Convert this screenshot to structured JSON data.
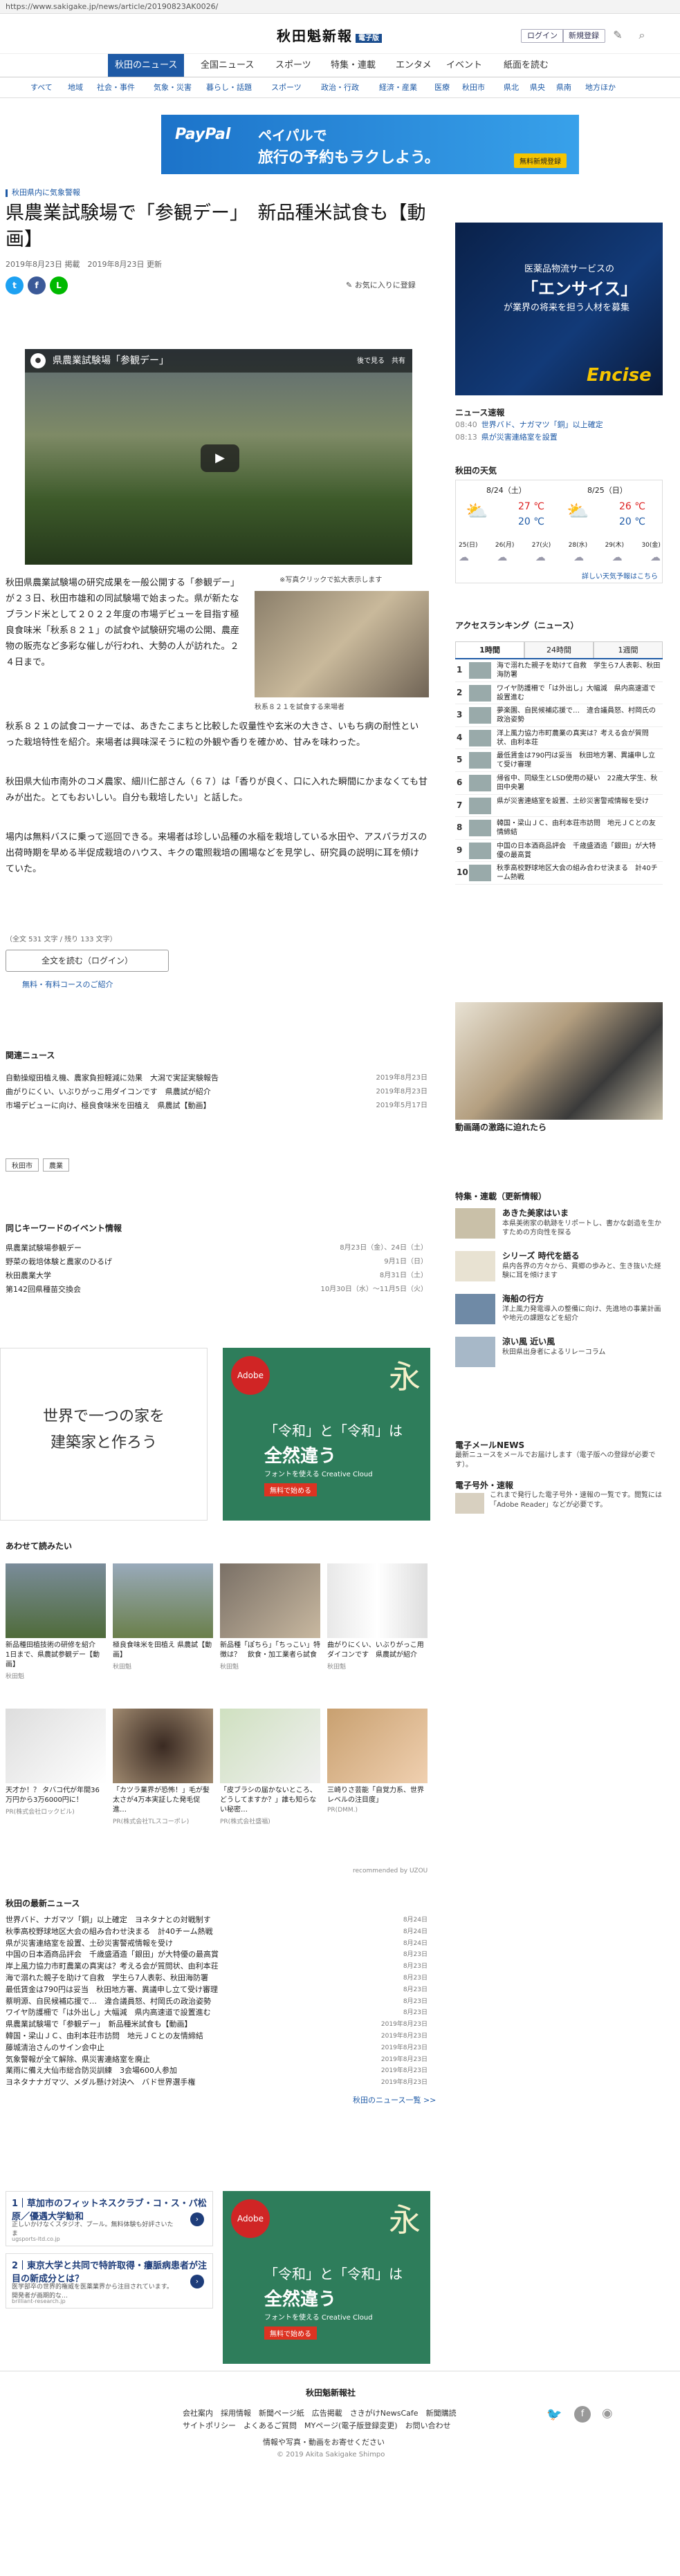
{
  "url": "https://www.sakigake.jp/news/article/20190823AK0026/",
  "header": {
    "logo": "秋田魁新報",
    "logo_tag": "電子版",
    "login": "ログイン",
    "register": "新規登録"
  },
  "nav1": [
    "秋田のニュース",
    "全国ニュース",
    "スポーツ",
    "特集・連載",
    "エンタメ",
    "イベント",
    "紙面を読む"
  ],
  "nav2": [
    "すべて",
    "地域",
    "社会・事件",
    "気象・災害",
    "暮らし・話題",
    "スポーツ",
    "政治・行政",
    "経済・産業",
    "医療",
    "秋田市",
    "県北",
    "県央",
    "県南",
    "地方ほか"
  ],
  "ad1": {
    "brand": "PayPal",
    "line1": "ペイパルで",
    "line2": "旅行の予約もラクしよう。",
    "cta": "無料新規登録"
  },
  "breadcrumb": "秋田県内に気象警報",
  "article": {
    "title": "県農業試験場で「参観デー」　新品種米試食も【動画】",
    "dates": "2019年8月23日 掲載　2019年8月23日 更新",
    "fav": "お気に入りに登録",
    "video_title": "県農業試験場「参観デー」",
    "video_actions": "後で見る　共有",
    "photo_note": "※写真クリックで拡大表示します",
    "photo_caption": "秋系８２１を試食する来場者",
    "p1": "秋田県農業試験場の研究成果を一般公開する「参観デー」が２３日、秋田市雄和の同試験場で始まった。県が新たなブランド米として２０２２年度の市場デビューを目指す極良食味米「秋系８２１」の試食や試験研究場の公開、農産物の販売など多彩な催しが行われ、大勢の人が訪れた。２４日まで。",
    "p2": "秋系８２１の試食コーナーでは、あきたこまちと比較した収量性や玄米の大きさ、いもち病の耐性といった栽培特性を紹介。来場者は興味深そうに粒の外観や香りを確かめ、甘みを味わった。",
    "p3": "秋田県大仙市南外のコメ農家、細川仁部さん（６７）は「香りが良く、口に入れた瞬間にかまなくても甘みが出た。とてもおいしい。自分も栽培したい」と話した。",
    "p4": "場内は無料バスに乗って巡回できる。来場者は珍しい品種の水稲を栽培している水田や、アスパラガスの出荷時期を早める半促成栽培のハウス、キクの電照栽培の圃場などを見学し、研究員の説明に耳を傾けていた。",
    "count": "（全文 531 文字 / 残り 133 文字）",
    "full_button": "全文を読む（ログイン）",
    "course_link": "無料・有料コースのご紹介"
  },
  "related": {
    "heading": "関連ニュース",
    "items": [
      {
        "t": "自動操縦田植え機、農家負担軽減に効果　大潟で実証実験報告",
        "d": "2019年8月23日"
      },
      {
        "t": "曲がりにくい、いぶりがっこ用ダイコンです　県農試が紹介",
        "d": "2019年8月23日"
      },
      {
        "t": "市場デビューに向け、極良食味米を田植え　県農試【動画】",
        "d": "2019年5月17日"
      }
    ]
  },
  "tags": [
    "秋田市",
    "農業"
  ],
  "events": {
    "heading": "同じキーワードのイベント情報",
    "items": [
      {
        "t": "県農業試験場参観デー",
        "d": "8月23日（金）、24日（土）"
      },
      {
        "t": "野菜の栽培体験と農家のひるげ",
        "d": "9月1日（日）"
      },
      {
        "t": "秋田農業大学",
        "d": "8月31日（土）"
      },
      {
        "t": "第142回県種苗交換会",
        "d": "10月30日（水）～11月5日（火）"
      }
    ]
  },
  "ad_house": {
    "l1": "世界で一つの家を",
    "l2": "建築家と作ろう"
  },
  "ad_adobe": {
    "badge": "Adobe",
    "kanji": "永",
    "k1": "「令和」と「令和」は",
    "k2": "全然違う",
    "k3": "フォントを使える Creative Cloud",
    "cta": "無料で始める"
  },
  "recommend": {
    "heading": "あわせて読みたい",
    "items": [
      {
        "c": "新品種田植技術の研修を紹介　1日まで、県農試参観デー【動画】",
        "s": "秋田魁"
      },
      {
        "c": "極良食味米を田植え 県農試【動画】",
        "s": "秋田魁"
      },
      {
        "c": "新品種「ぽちら」「ちっこい」特徴は？　飲食・加工業者ら試食",
        "s": "秋田魁"
      },
      {
        "c": "曲がりにくい、いぶりがっこ用ダイコンです　県農試が紹介",
        "s": "秋田魁"
      },
      {
        "c": "天才か！？ タバコ代が年間36万円から3万6000円に！",
        "s": "PR(株式会社ロックビル)"
      },
      {
        "c": "「カツラ業界が恐怖！」毛が髪太さが4万本実証した発毛促進…",
        "s": "PR(株式会社TLスコーポレ)"
      },
      {
        "c": "「皮ブラシの届かないところ、どうしてますか？」誰も知らない秘密…",
        "s": "PR(株式会社盛福)"
      },
      {
        "c": "三崎りさ芸能「自覚力系、世界レベルの注目度」",
        "s": "PR(DMM.)"
      }
    ],
    "uzou": "recommended by UZOU"
  },
  "latest": {
    "heading": "秋田の最新ニュース",
    "items": [
      {
        "t": "世界バド、ナガマツ「銅」以上確定　ヨネタナとの対戦制す",
        "d": "8月24日"
      },
      {
        "t": "秋季高校野球地区大会の組み合わせ決まる　計40チーム熱戦",
        "d": "8月24日"
      },
      {
        "t": "県が災害連絡室を設置、土砂災害警戒情報を受け",
        "d": "8月24日"
      },
      {
        "t": "中国の日本酒商品評会　千歳盛酒造「銀田」が大特優の最高賞",
        "d": "8月23日"
      },
      {
        "t": "岸上風力協力市町農業の真実は？考える会が質問状、由利本荘",
        "d": "8月23日"
      },
      {
        "t": "海で溺れた親子を助けて自救　学生ら7人表彰、秋田海防署",
        "d": "8月23日"
      },
      {
        "t": "最低賃金は790円は妥当　秋田地方署、異議申し立て受け審理",
        "d": "8月23日"
      },
      {
        "t": "蔡明源、自民候補応援で…　違合議員怒、村岡氏の政治姿勢",
        "d": "8月23日"
      },
      {
        "t": "ワイヤ防護柵で「は外出し」大幅減　県内高速道で設置進む",
        "d": "8月23日"
      },
      {
        "t": "県農業試験場で「参観デー」　新品種米試食も【動画】",
        "d": "2019年8月23日"
      },
      {
        "t": "韓国・梁山ＪＣ、由利本荘市訪問　地元ＪＣとの友情締結",
        "d": "2019年8月23日"
      },
      {
        "t": "藤城清治さんのサイン会中止",
        "d": "2019年8月23日"
      },
      {
        "t": "気象警報が全て解除、県災害連絡室を廃止",
        "d": "2019年8月23日"
      },
      {
        "t": "業雨に備え大仙市総合防災訓練　3会場600人参加",
        "d": "2019年8月23日"
      },
      {
        "t": "ヨネタナナガマツ、メダル懸け対決へ　バド世界選手権",
        "d": "2019年8月23日"
      }
    ],
    "more": "秋田のニュース一覧 >>"
  },
  "small_ads": [
    {
      "n": "1｜草加市のフィットネスクラブ・コ・ス・パ松原／優遇大学勧和",
      "d": "正しいかけなくスタジオ、プール。無料体験も好評さいたま",
      "u": "ugsports-ltd.co.jp"
    },
    {
      "n": "2｜東京大学と共同で特許取得・瘻脈病患者が注目の新成分とは？",
      "d": "医学部卒の世界的権威を医薬業界から注目されています。開発者が画期的な…",
      "u": "brilliant-research.jp"
    }
  ],
  "footer": {
    "name": "秋田魁新報社",
    "links1": "会社案内　採用情報　新聞ページ紙　広告掲載　さきがけNewsCafe　新聞購読",
    "links2": "サイトポリシー　よくあるご質問　MYページ(電子版登録変更)　お問い合わせ",
    "links3": "情報や写真・動画をお寄せください",
    "copyright": "© 2019 Akita Sakigake Shimpo"
  },
  "sidebar": {
    "ad": {
      "t1": "医薬品物流サービスの",
      "t2": "「エンサイス」",
      "t3": "が業界の将来を担う人材を募集",
      "t4": "Encise"
    },
    "flash": {
      "heading": "ニュース速報",
      "items": [
        {
          "time": "08:40",
          "t": "世界バド、ナガマツ「銅」以上確定"
        },
        {
          "time": "08:13",
          "t": "県が災害連絡室を設置"
        }
      ]
    },
    "weather": {
      "heading": "秋田の天気",
      "d1": "8/24（土）",
      "d2": "8/25（日）",
      "hi1": "27 ℃",
      "lo1": "20 ℃",
      "hi2": "26 ℃",
      "lo2": "20 ℃",
      "week": [
        "25(日)",
        "26(月)",
        "27(火)",
        "28(水)",
        "29(木)",
        "30(金)"
      ],
      "more": "詳しい天気予報はこちら"
    },
    "ranking": {
      "heading": "アクセスランキング（ニュース）",
      "tabs": [
        "1時間",
        "24時間",
        "1週間"
      ],
      "items": [
        "海で溺れた親子を助けて自救　学生ら7人表彰、秋田海防署",
        "ワイヤ防護柵で「は外出し」大幅減　県内高速道で設置進む",
        "夢楽園、自民候補応援で…　違合議員怒、村岡氏の政治姿勢",
        "洋上風力協力市町農業の真実は？考える会が質問状、由利本荘",
        "最低賃金は790円は妥当　秋田地方署、異議申し立て受け審理",
        "帰省中、同級生とLSD使用の疑い　22歳大学生、秋田中央署",
        "県が災害連絡室を設置、土砂災害警戒情報を受け",
        "韓国・梁山ＪＣ、由利本荘市訪問　地元ＪＣとの友情締結",
        "中国の日本酒商品評会　千歳盛酒造「銀田」が大特優の最高賞",
        "秋季高校野球地区大会の組み合わせ決まる　計40チーム熱戦"
      ]
    },
    "photo_caption": "動画踊の激路に迫れたら",
    "features": {
      "heading": "特集・連載（更新情報）",
      "items": [
        {
          "t": "あきた美家はいま",
          "d": "本県美術家の軌跡をリポートし、書かな創造を生かすための方向性を探る"
        },
        {
          "t": "シリーズ 時代を語る",
          "d": "県内各界の方々から、貫郷の歩みと、生き抜いた経験に耳を傾けます"
        },
        {
          "t": "海船の行方",
          "d": "洋上風力発電導入の整備に向け、先進地の事業計画や地元の課題などを紹介"
        },
        {
          "t": "涼い風 近い風",
          "d": "秋田県出身者によるリレーコラム"
        }
      ]
    },
    "mailnews": {
      "t": "電子メールNEWS",
      "d": "最新ニュースをメールでお届けします（電子版への登録が必要です）。"
    },
    "edition": {
      "t": "電子号外・速報",
      "d": "これまで発行した電子号外・速報の一覧です。閲覧には「Adobe Reader」などが必要です。"
    }
  }
}
